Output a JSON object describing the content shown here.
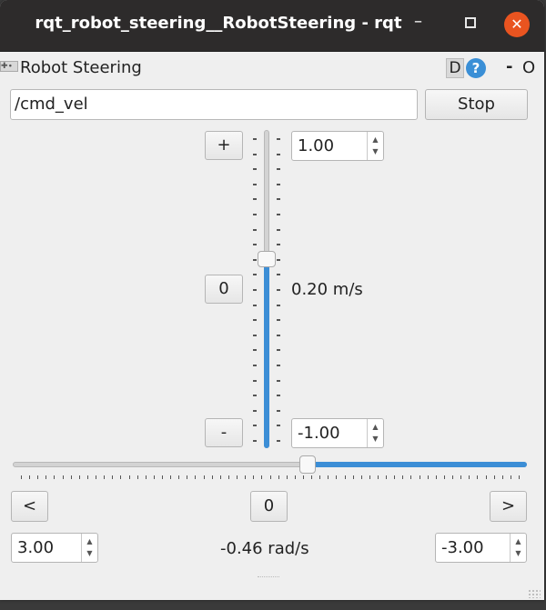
{
  "window": {
    "title": "rqt_robot_steering__RobotSteering - rqt",
    "minimize_label": "–",
    "close_label": "✕"
  },
  "plugin": {
    "icon": "joystick-icon",
    "title": "Robot Steering",
    "d_button": "D",
    "help_button": "?",
    "minimize": "-",
    "close": "O"
  },
  "topic": {
    "value": "/cmd_vel"
  },
  "stop_button": "Stop",
  "linear": {
    "plus_button": "+",
    "zero_button": "0",
    "minus_button": "-",
    "max_value": "1.00",
    "min_value": "-1.00",
    "current_label": "0.20 m/s",
    "current": 0.2,
    "range": [
      -1.0,
      1.0
    ],
    "tick_count": 21
  },
  "angular": {
    "left_button": "<",
    "zero_button": "0",
    "right_button": ">",
    "left_value": "3.00",
    "right_value": "-3.00",
    "current_label": "-0.46 rad/s",
    "current": -0.46,
    "range_left_to_right": [
      3.0,
      -3.0
    ],
    "tick_count": 61
  },
  "colors": {
    "accent": "#3c8ed6",
    "titlebar": "#2d2b2b",
    "close": "#e95420"
  }
}
